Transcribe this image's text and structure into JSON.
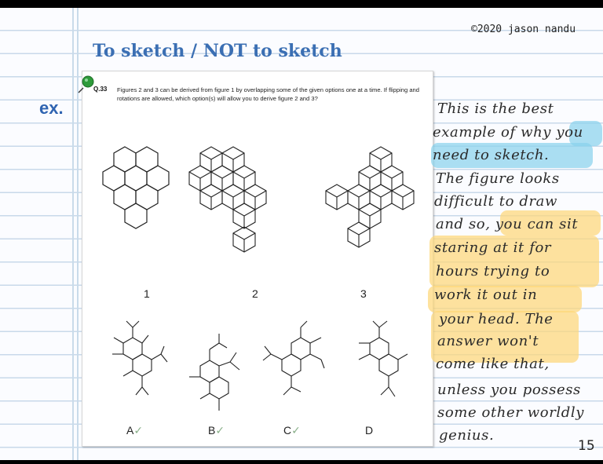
{
  "copyright": "©2020 jason nandu",
  "title": "To sketch / NOT to sketch",
  "ex_label": "ex.",
  "page_number": "15",
  "question": {
    "number": "Q.33",
    "text": "Figures 2 and 3 can be derived from figure 1 by overlapping some of the given options one at a time. If flipping and rotations are allowed, which option(s) will allow you to derive figure 2 and 3?",
    "figure_labels": [
      "1",
      "2",
      "3"
    ],
    "options": [
      {
        "label": "A",
        "checked": true
      },
      {
        "label": "B",
        "checked": true
      },
      {
        "label": "C",
        "checked": true
      },
      {
        "label": "D",
        "checked": false
      }
    ],
    "check_mark": "✓"
  },
  "handwritten_notes": [
    "This is the best",
    "example of why you",
    "need to sketch.",
    "The figure looks",
    "difficult to draw",
    "and so, you can sit",
    "staring at it for",
    "hours trying to",
    "work it out in",
    "your head. The",
    "answer won't",
    "come like that,",
    "unless you possess",
    "some other worldly",
    "genius."
  ],
  "colors": {
    "title": "#3b6fb3",
    "highlight_blue": "#87d1ec",
    "highlight_yellow": "#fdd778",
    "pin": "#2e9b3a",
    "check": "#8ab08a"
  }
}
